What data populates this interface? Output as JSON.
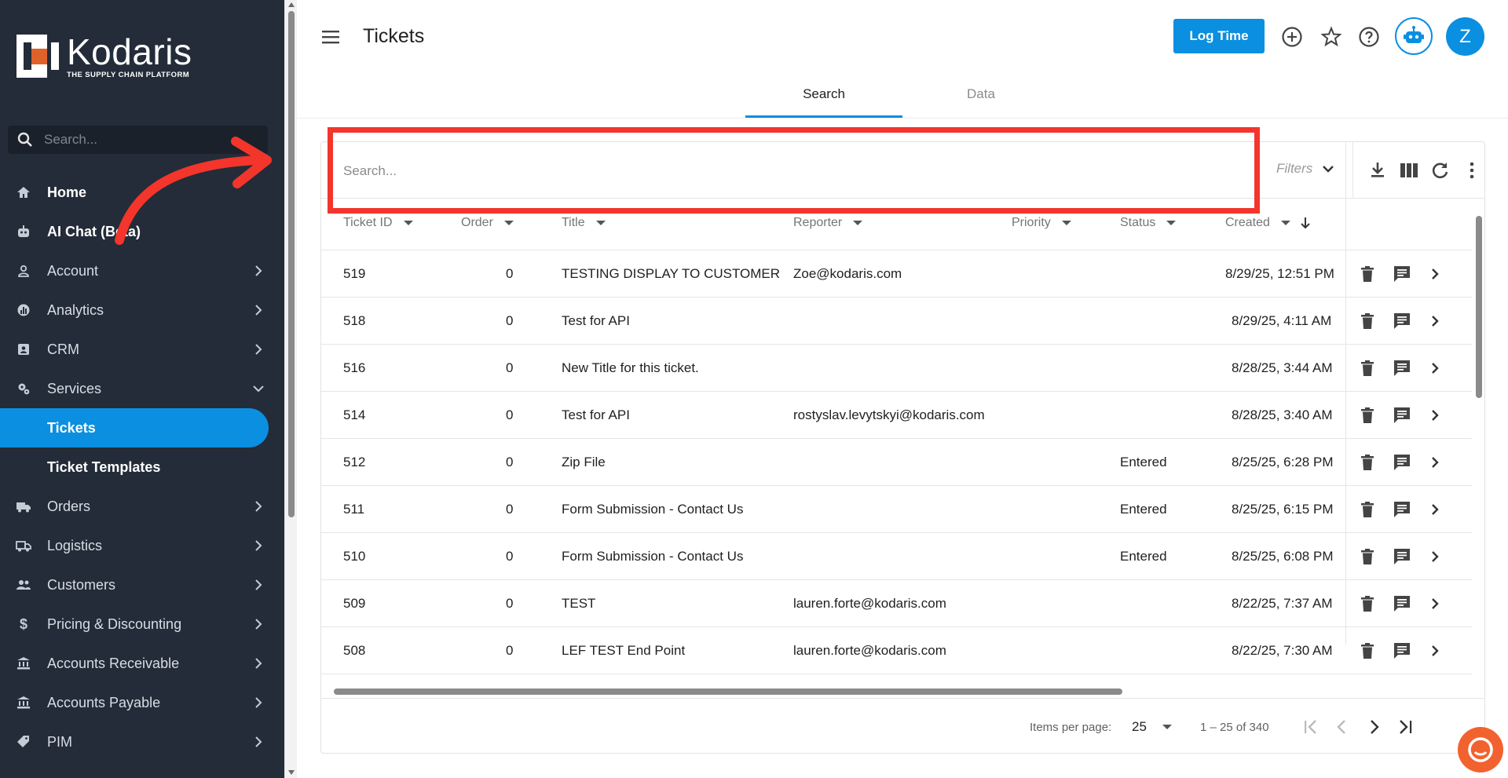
{
  "sidebar": {
    "logo_name": "Kodaris",
    "logo_tagline": "THE SUPPLY CHAIN PLATFORM",
    "search_placeholder": "Search...",
    "items": [
      {
        "label": "Home",
        "icon": "home-icon"
      },
      {
        "label": "AI Chat (Beta)",
        "icon": "robot-icon"
      },
      {
        "label": "Account",
        "icon": "person-icon"
      },
      {
        "label": "Analytics",
        "icon": "analytics-icon"
      },
      {
        "label": "CRM",
        "icon": "contact-card-icon"
      },
      {
        "label": "Services",
        "icon": "gears-icon"
      },
      {
        "label": "Tickets"
      },
      {
        "label": "Ticket Templates"
      },
      {
        "label": "Orders",
        "icon": "truck-icon"
      },
      {
        "label": "Logistics",
        "icon": "shipping-icon"
      },
      {
        "label": "Customers",
        "icon": "people-icon"
      },
      {
        "label": "Pricing & Discounting",
        "icon": "dollar-icon"
      },
      {
        "label": "Accounts Receivable",
        "icon": "bank-icon"
      },
      {
        "label": "Accounts Payable",
        "icon": "bank-icon"
      },
      {
        "label": "PIM",
        "icon": "tag-icon"
      }
    ]
  },
  "header": {
    "title": "Tickets",
    "log_time_label": "Log Time",
    "avatar_initial": "Z"
  },
  "tabs": [
    {
      "label": "Search",
      "active": true
    },
    {
      "label": "Data",
      "active": false
    }
  ],
  "toolbar": {
    "search_placeholder": "Search...",
    "filters_label": "Filters"
  },
  "table": {
    "columns": [
      "Ticket ID",
      "Order",
      "Title",
      "Reporter",
      "Priority",
      "Status",
      "Created"
    ],
    "rows": [
      {
        "id": "519",
        "order": "0",
        "title": "TESTING DISPLAY TO CUSTOMER",
        "reporter": "Zoe@kodaris.com",
        "priority": "",
        "status": "",
        "created": "8/29/25, 12:51 PM"
      },
      {
        "id": "518",
        "order": "0",
        "title": "Test for API",
        "reporter": "",
        "priority": "",
        "status": "",
        "created": "8/29/25, 4:11 AM"
      },
      {
        "id": "516",
        "order": "0",
        "title": "New Title for this ticket.",
        "reporter": "",
        "priority": "",
        "status": "",
        "created": "8/28/25, 3:44 AM"
      },
      {
        "id": "514",
        "order": "0",
        "title": "Test for API",
        "reporter": "rostyslav.levytskyi@kodaris.com",
        "priority": "",
        "status": "",
        "created": "8/28/25, 3:40 AM"
      },
      {
        "id": "512",
        "order": "0",
        "title": "Zip File",
        "reporter": "",
        "priority": "",
        "status": "Entered",
        "created": "8/25/25, 6:28 PM"
      },
      {
        "id": "511",
        "order": "0",
        "title": "Form Submission - Contact Us",
        "reporter": "",
        "priority": "",
        "status": "Entered",
        "created": "8/25/25, 6:15 PM"
      },
      {
        "id": "510",
        "order": "0",
        "title": "Form Submission - Contact Us",
        "reporter": "",
        "priority": "",
        "status": "Entered",
        "created": "8/25/25, 6:08 PM"
      },
      {
        "id": "509",
        "order": "0",
        "title": "TEST",
        "reporter": "lauren.forte@kodaris.com",
        "priority": "",
        "status": "",
        "created": "8/22/25, 7:37 AM"
      },
      {
        "id": "508",
        "order": "0",
        "title": "LEF TEST End Point",
        "reporter": "lauren.forte@kodaris.com",
        "priority": "",
        "status": "",
        "created": "8/22/25, 7:30 AM"
      }
    ]
  },
  "paginator": {
    "items_per_page_label": "Items per page:",
    "items_per_page": "25",
    "range": "1 – 25 of 340"
  },
  "colors": {
    "sidebar_bg": "#232c38",
    "accent": "#0b8fe0",
    "highlight": "#f3352b",
    "chat_bubble": "#f2622f"
  }
}
